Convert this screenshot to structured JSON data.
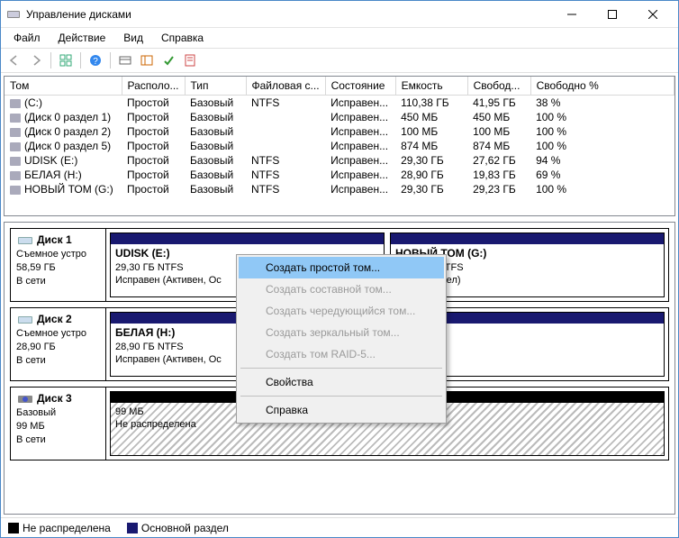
{
  "window": {
    "title": "Управление дисками"
  },
  "menu": {
    "file": "Файл",
    "action": "Действие",
    "view": "Вид",
    "help": "Справка"
  },
  "volumeTable": {
    "headers": {
      "vol": "Том",
      "layout": "Располо...",
      "type": "Тип",
      "fs": "Файловая с...",
      "status": "Состояние",
      "cap": "Емкость",
      "free": "Свобод...",
      "freepct": "Свободно %"
    },
    "rows": [
      {
        "vol": "(C:)",
        "layout": "Простой",
        "type": "Базовый",
        "fs": "NTFS",
        "status": "Исправен...",
        "cap": "110,38 ГБ",
        "free": "41,95 ГБ",
        "freepct": "38 %"
      },
      {
        "vol": "(Диск 0 раздел 1)",
        "layout": "Простой",
        "type": "Базовый",
        "fs": "",
        "status": "Исправен...",
        "cap": "450 МБ",
        "free": "450 МБ",
        "freepct": "100 %"
      },
      {
        "vol": "(Диск 0 раздел 2)",
        "layout": "Простой",
        "type": "Базовый",
        "fs": "",
        "status": "Исправен...",
        "cap": "100 МБ",
        "free": "100 МБ",
        "freepct": "100 %"
      },
      {
        "vol": "(Диск 0 раздел 5)",
        "layout": "Простой",
        "type": "Базовый",
        "fs": "",
        "status": "Исправен...",
        "cap": "874 МБ",
        "free": "874 МБ",
        "freepct": "100 %"
      },
      {
        "vol": "UDISK (E:)",
        "layout": "Простой",
        "type": "Базовый",
        "fs": "NTFS",
        "status": "Исправен...",
        "cap": "29,30 ГБ",
        "free": "27,62 ГБ",
        "freepct": "94 %"
      },
      {
        "vol": "БЕЛАЯ (H:)",
        "layout": "Простой",
        "type": "Базовый",
        "fs": "NTFS",
        "status": "Исправен...",
        "cap": "28,90 ГБ",
        "free": "19,83 ГБ",
        "freepct": "69 %"
      },
      {
        "vol": "НОВЫЙ ТОМ (G:)",
        "layout": "Простой",
        "type": "Базовый",
        "fs": "NTFS",
        "status": "Исправен...",
        "cap": "29,30 ГБ",
        "free": "29,23 ГБ",
        "freepct": "100 %"
      }
    ]
  },
  "disks": [
    {
      "name": "Диск 1",
      "bus": "Съемное устро",
      "cap": "58,59 ГБ",
      "state": "В сети",
      "parts": [
        {
          "title": "UDISK  (E:)",
          "line2": "29,30 ГБ NTFS",
          "line3": "Исправен (Активен, Ос"
        },
        {
          "title": "НОВЫЙ ТОМ  (G:)",
          "line2": "29,30 ГБ NTFS",
          "line3": "овной раздел)"
        }
      ]
    },
    {
      "name": "Диск 2",
      "bus": "Съемное устро",
      "cap": "28,90 ГБ",
      "state": "В сети",
      "parts": [
        {
          "title": "БЕЛАЯ  (H:)",
          "line2": "28,90 ГБ NTFS",
          "line3": "Исправен (Активен, Ос"
        }
      ]
    },
    {
      "name": "Диск 3",
      "bus": "Базовый",
      "cap": "99 МБ",
      "state": "В сети",
      "parts": [
        {
          "unalloc": true,
          "title": "",
          "line2": "99 МБ",
          "line3": "Не распределена"
        }
      ]
    }
  ],
  "legend": {
    "unalloc": "Не распределена",
    "primary": "Основной раздел"
  },
  "context": {
    "items": [
      {
        "label": "Создать простой том...",
        "hl": true
      },
      {
        "label": "Создать составной том...",
        "dis": true
      },
      {
        "label": "Создать чередующийся том...",
        "dis": true
      },
      {
        "label": "Создать зеркальный том...",
        "dis": true
      },
      {
        "label": "Создать том RAID-5...",
        "dis": true
      },
      {
        "sep": true
      },
      {
        "label": "Свойства"
      },
      {
        "sep": true
      },
      {
        "label": "Справка"
      }
    ]
  }
}
